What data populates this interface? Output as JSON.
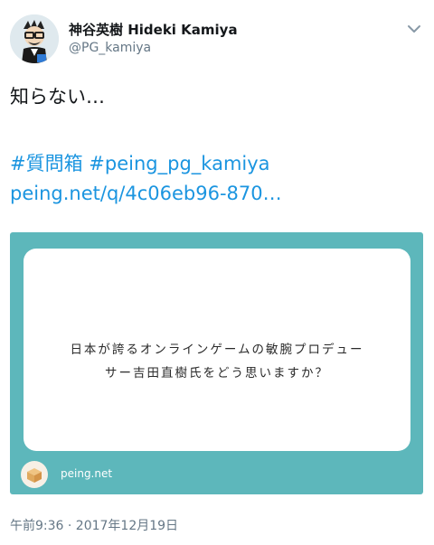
{
  "user": {
    "display_name": "神谷英樹 Hideki Kamiya",
    "handle": "@PG_kamiya"
  },
  "tweet": {
    "text": "知らない…",
    "hashtags": [
      "#質問箱",
      "#peing_pg_kamiya"
    ],
    "link": "peing.net/q/4c06eb96-870…"
  },
  "card": {
    "question_lines": [
      "日本が誇るオンラインゲームの敏腕プロデュー",
      "サー吉田直樹氏をどう思いますか？"
    ],
    "domain": "peing.net",
    "background_color": "#5db7bb"
  },
  "timestamp": "午前9:36 · 2017年12月19日",
  "icons": {
    "menu": "chevron-down-icon",
    "card_logo": "peing-box-icon"
  }
}
